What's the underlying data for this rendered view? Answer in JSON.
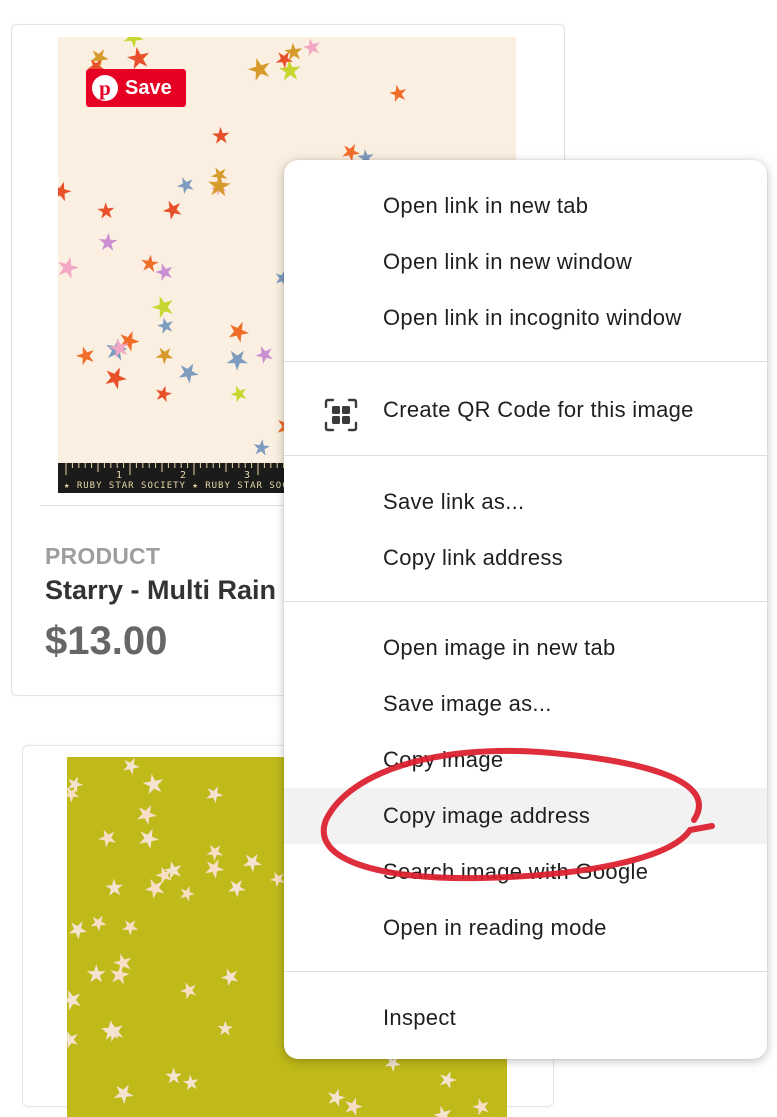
{
  "product_card": {
    "pin_label": "Save",
    "ruler_text": "★ RUBY STAR SOCIETY ★ RUBY STAR SOCIETY",
    "ruler_numbers": [
      "1",
      "2",
      "3"
    ],
    "kicker": "PRODUCT",
    "name": "Starry - Multi Rain",
    "price": "$13.00"
  },
  "context_menu": {
    "items": [
      {
        "label": "Open link in new tab"
      },
      {
        "label": "Open link in new window"
      },
      {
        "label": "Open link in incognito window"
      },
      {
        "label": "Create QR Code for this image",
        "icon": "qr-code-icon"
      },
      {
        "label": "Save link as..."
      },
      {
        "label": "Copy link address"
      },
      {
        "label": "Open image in new tab"
      },
      {
        "label": "Save image as..."
      },
      {
        "label": "Copy image"
      },
      {
        "label": "Copy image address",
        "highlighted": true
      },
      {
        "label": "Search image with Google"
      },
      {
        "label": "Open in reading mode"
      },
      {
        "label": "Inspect"
      }
    ]
  },
  "colors": {
    "pinterest_red": "#e60023",
    "fabric1_bg": "#faefe0",
    "fabric2_bg": "#bfb91a",
    "annotation_red": "#dc1e2d",
    "menu_hover": "#f2f2f2"
  }
}
